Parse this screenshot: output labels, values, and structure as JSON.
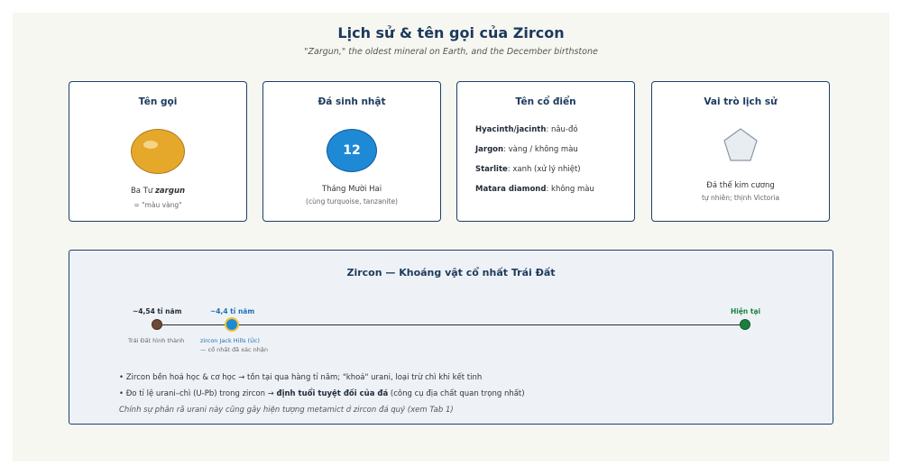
{
  "header": {
    "title": "Lịch sử & tên gọi của Zircon",
    "subtitle": "\"Zargun,\" the oldest mineral on Earth, and the December birthstone"
  },
  "cards": {
    "name": {
      "title": "Tên gọi",
      "line1_prefix": "Ba Tư ",
      "line1_word": "zargun",
      "line2": "= \"màu vàng\""
    },
    "birthstone": {
      "title": "Đá sinh nhật",
      "number": "12",
      "line1": "Tháng Mười Hai",
      "line2": "(cùng turquoise, tanzanite)"
    },
    "classic": {
      "title": "Tên cổ điển",
      "items": [
        {
          "name": "Hyacinth/jacinth",
          "desc": ": nâu-đỏ"
        },
        {
          "name": "Jargon",
          "desc": ": vàng / không màu"
        },
        {
          "name": "Starlite",
          "desc": ": xanh (xử lý nhiệt)"
        },
        {
          "name": "Matara diamond",
          "desc": ": không màu"
        }
      ]
    },
    "history": {
      "title": "Vai trò lịch sử",
      "line1": "Đá thế kim cương",
      "line2": "tự nhiên; thịnh Victoria"
    }
  },
  "timeline": {
    "title": "Zircon — Khoáng vật cổ nhất Trái Đất",
    "events": [
      {
        "label": "~4,54 tỉ năm",
        "sub1": "Trái Đất hình thành",
        "sub2": "",
        "color": "#6b4a36"
      },
      {
        "label": "~4,4 tỉ năm",
        "sub1": "zircon Jack Hills (Úc)",
        "sub2": "— cổ nhất đã xác nhận",
        "color": "#1e8ad6"
      },
      {
        "label": "Hiện tại",
        "sub1": "",
        "sub2": "",
        "color": "#1a8040"
      }
    ],
    "bullet1_text": "• Zircon bền hoá học & cơ học → tồn tại qua hàng tỉ năm; \"khoá\" urani, loại trừ chì khi kết tinh",
    "bullet2_prefix": "• Đo tỉ lệ urani–chì (U-Pb) trong zircon → ",
    "bullet2_bold": "định tuổi tuyệt đối của đá",
    "bullet2_suffix": " (công cụ địa chất quan trọng nhất)",
    "note": "Chính sự phân rã urani này cũng gây hiện tượng metamict ở zircon đá quý (xem Tab 1)"
  }
}
